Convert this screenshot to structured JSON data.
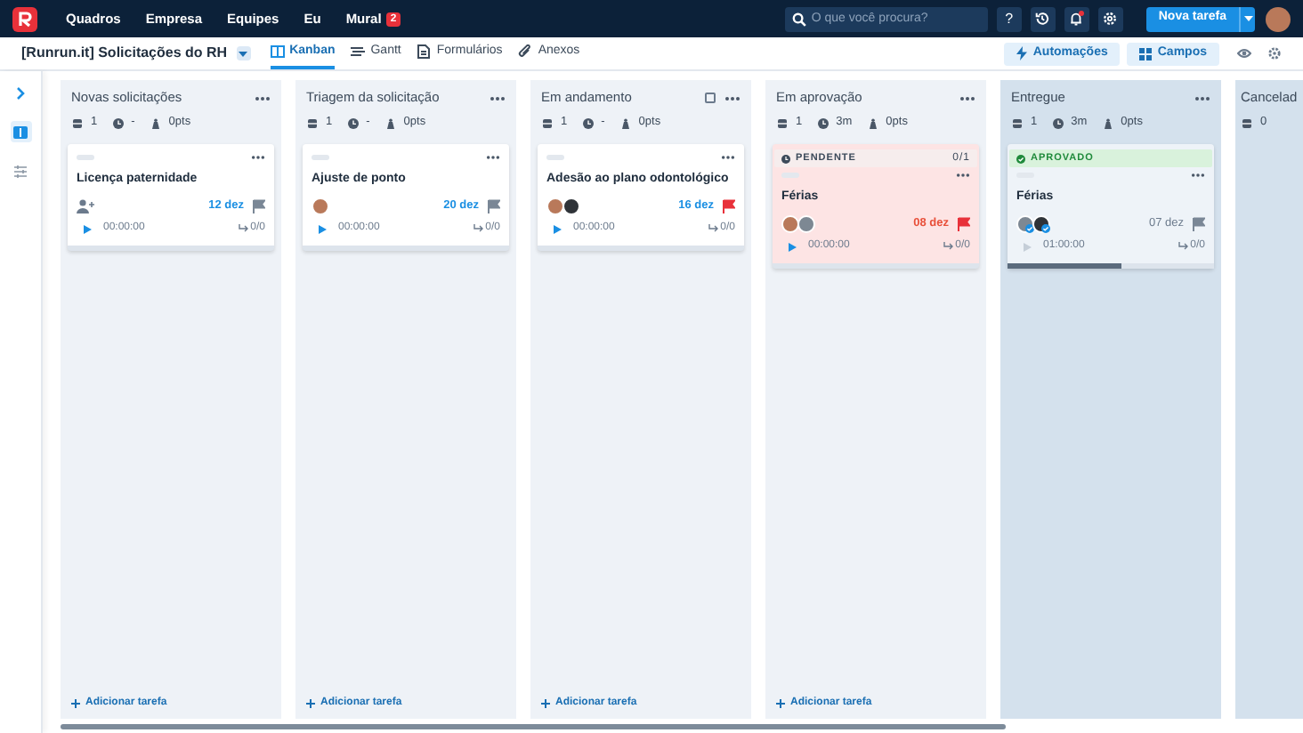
{
  "nav": {
    "menu": [
      {
        "label": "Quadros"
      },
      {
        "label": "Empresa"
      },
      {
        "label": "Equipes"
      },
      {
        "label": "Eu"
      },
      {
        "label": "Mural",
        "badge": "2"
      }
    ],
    "search": {
      "placeholder": "O que você procura?"
    },
    "help": "?",
    "notifications_unread": true,
    "new_task": "Nova tarefa"
  },
  "board_bar": {
    "title": "[Runrun.it] Solicitações do RH",
    "tabs": [
      {
        "label": "Kanban",
        "kind": "kanban",
        "selected": true
      },
      {
        "label": "Gantt",
        "kind": "gantt",
        "selected": false
      },
      {
        "label": "Formulários",
        "kind": "forms",
        "selected": false
      },
      {
        "label": "Anexos",
        "kind": "attachments",
        "selected": false
      }
    ],
    "automations": "Automações",
    "fields": "Campos"
  },
  "sidebar": {
    "items": [
      {
        "kind": "expand",
        "selected": false
      },
      {
        "kind": "board",
        "selected": true
      },
      {
        "kind": "filters",
        "selected": false
      }
    ]
  },
  "columns": [
    {
      "title": "Novas solicitações",
      "done": false,
      "count": "1",
      "time": "-",
      "points": "0pts",
      "add": "Adicionar tarefa",
      "cards": [
        {
          "title": "Licença paternidade",
          "unassigned": true,
          "date": "12 dez",
          "urgent": false,
          "timer": "00:00:00",
          "timer_disabled": false,
          "subtasks": "0/0"
        }
      ]
    },
    {
      "title": "Triagem da solicitação",
      "done": false,
      "count": "1",
      "time": "-",
      "points": "0pts",
      "add": "Adicionar tarefa",
      "cards": [
        {
          "title": "Ajuste de ponto",
          "assignees": [
            {
              "kind": "woman",
              "verified": false
            }
          ],
          "date": "20 dez",
          "urgent": false,
          "timer": "00:00:00",
          "timer_disabled": false,
          "subtasks": "0/0"
        }
      ]
    },
    {
      "title": "Em andamento",
      "done": false,
      "checkbox": true,
      "count": "1",
      "time": "-",
      "points": "0pts",
      "add": "Adicionar tarefa",
      "cards": [
        {
          "title": "Adesão ao plano odontológico",
          "assignees": [
            {
              "kind": "woman",
              "verified": false
            },
            {
              "kind": "dark",
              "verified": false
            }
          ],
          "date": "16 dez",
          "urgent": true,
          "timer": "00:00:00",
          "timer_disabled": false,
          "subtasks": "0/0"
        }
      ]
    },
    {
      "title": "Em aprovação",
      "done": false,
      "count": "1",
      "time": "3m",
      "points": "0pts",
      "add": "Adicionar tarefa",
      "cards": [
        {
          "badge": {
            "kind": "pending",
            "label": "PENDENTE",
            "counter": "0/1"
          },
          "title": "Férias",
          "assignees": [
            {
              "kind": "woman",
              "verified": false
            },
            {
              "kind": "man",
              "verified": false
            }
          ],
          "date": "08 dez",
          "urgent": true,
          "overdue": true,
          "timer": "00:00:00",
          "timer_disabled": false,
          "subtasks": "0/0"
        }
      ]
    },
    {
      "title": "Entregue",
      "done": true,
      "count": "1",
      "time": "3m",
      "points": "0pts",
      "cards": [
        {
          "badge": {
            "kind": "approved",
            "label": "APROVADO"
          },
          "title": "Férias",
          "assignees": [
            {
              "kind": "man",
              "verified": true
            },
            {
              "kind": "dark",
              "verified": true
            }
          ],
          "date": "07 dez",
          "urgent": false,
          "timer": "01:00:00",
          "timer_disabled": true,
          "subtasks": "0/0",
          "level": 0.55
        }
      ]
    },
    {
      "title": "Cancelad",
      "done": true,
      "count": "0"
    }
  ]
}
